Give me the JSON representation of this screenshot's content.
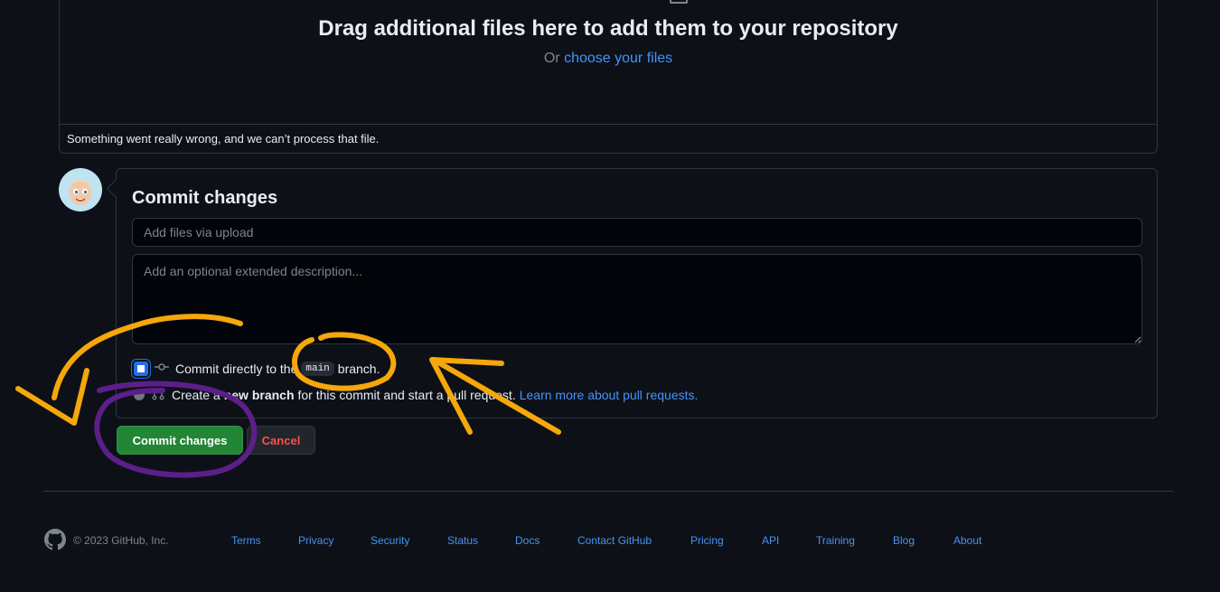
{
  "dropzone": {
    "title": "Drag additional files here to add them to your repository",
    "or_text": "Or",
    "choose_link": "choose your files",
    "error_message": "Something went really wrong, and we can’t process that file."
  },
  "commit": {
    "title": "Commit changes",
    "summary_placeholder": "Add files via upload",
    "description_placeholder": "Add an optional extended description...",
    "option_direct": {
      "text_before": "Commit directly to the",
      "branch": "main",
      "text_after": "branch.",
      "selected": true
    },
    "option_new_branch": {
      "text_before": "Create a",
      "bold": "new branch",
      "text_after": "for this commit and start a pull request.",
      "link": "Learn more about pull requests.",
      "selected": false
    },
    "commit_button": "Commit changes",
    "cancel_button": "Cancel"
  },
  "footer": {
    "copyright": "© 2023 GitHub, Inc.",
    "links": [
      "Terms",
      "Privacy",
      "Security",
      "Status",
      "Docs",
      "Contact GitHub",
      "Pricing",
      "API",
      "Training",
      "Blog",
      "About"
    ]
  },
  "colors": {
    "background": "#0d1117",
    "border": "#30363d",
    "link": "#4493f8",
    "primary_button": "#238636",
    "danger_text": "#f85149",
    "annotation_orange": "#f5a70b",
    "annotation_purple": "#5c1f8a"
  },
  "icons": {
    "upload": "file-icon",
    "commit": "git-commit-icon",
    "branch": "git-pull-request-icon",
    "logo": "github-mark-icon"
  }
}
